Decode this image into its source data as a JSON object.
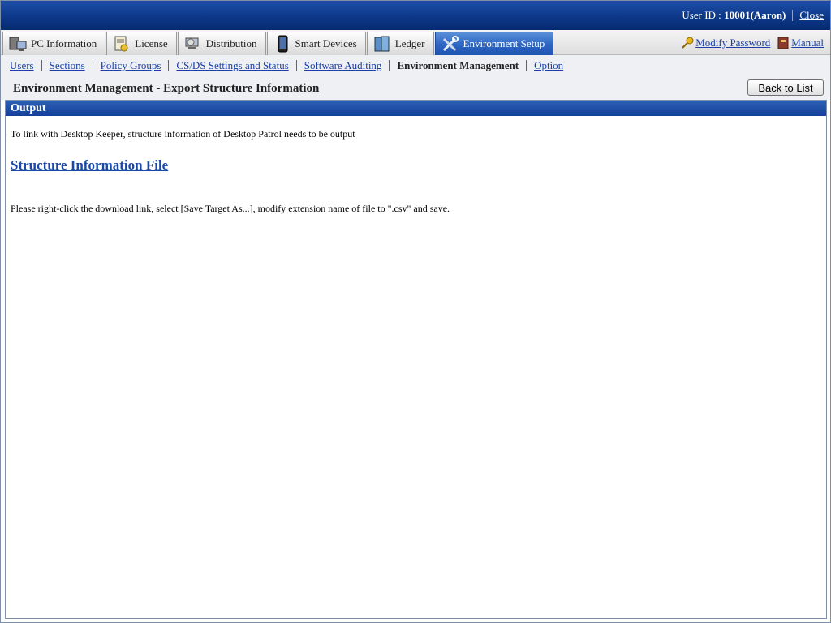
{
  "header": {
    "user_label": "User ID : ",
    "user_id": "10001(Aaron)",
    "close_label": "Close"
  },
  "tabs": [
    {
      "label": "PC Information",
      "icon": "pc-icon"
    },
    {
      "label": "License",
      "icon": "license-icon"
    },
    {
      "label": "Distribution",
      "icon": "distribution-icon"
    },
    {
      "label": "Smart Devices",
      "icon": "smart-device-icon"
    },
    {
      "label": "Ledger",
      "icon": "ledger-icon"
    },
    {
      "label": "Environment Setup",
      "icon": "tools-icon",
      "active": true
    }
  ],
  "right_links": {
    "modify_password": "Modify Password",
    "manual": "Manual"
  },
  "subnav": [
    {
      "label": "Users"
    },
    {
      "label": "Sections"
    },
    {
      "label": "Policy Groups"
    },
    {
      "label": "CS/DS Settings and Status"
    },
    {
      "label": "Software Auditing"
    },
    {
      "label": "Environment Management",
      "current": true
    },
    {
      "label": "Option"
    }
  ],
  "page": {
    "title": "Environment Management - Export Structure Information",
    "back_label": "Back to List"
  },
  "panel": {
    "heading": "Output",
    "description": "To link with Desktop Keeper, structure information of Desktop Patrol needs to be output",
    "file_link": "Structure Information File",
    "note": "Please right-click the download link, select [Save Target As...], modify extension name of file to \".csv\" and save."
  },
  "colors": {
    "header_blue": "#0e3a8c",
    "active_tab": "#2b65c2",
    "link_blue": "#1a3fa8"
  }
}
